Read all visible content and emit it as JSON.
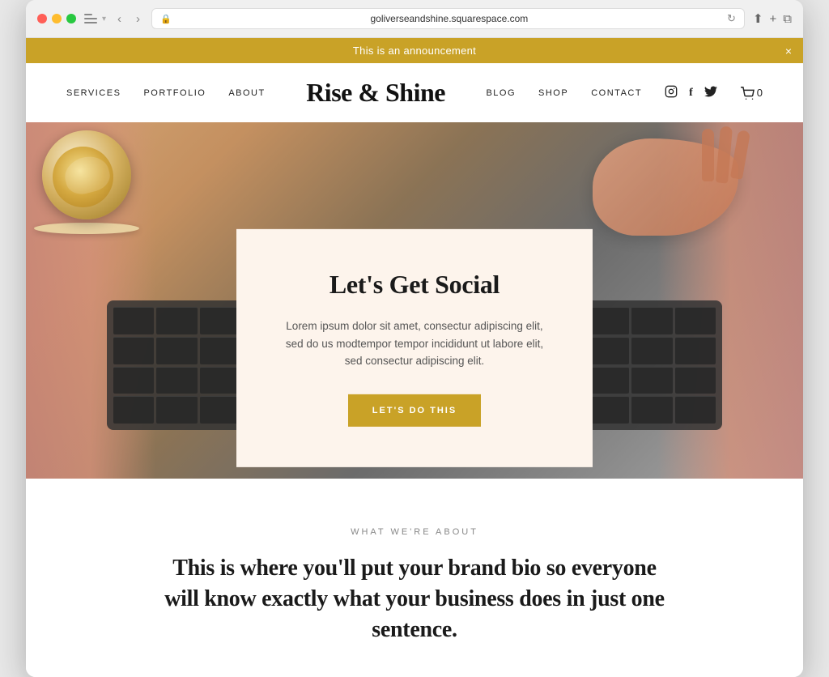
{
  "browser": {
    "url": "goliverseandshine.squarespace.com",
    "back_label": "‹",
    "forward_label": "›"
  },
  "announcement": {
    "text": "This is an announcement",
    "close_label": "×"
  },
  "navbar": {
    "logo": "Rise & Shine",
    "left_links": [
      {
        "label": "SERVICES",
        "key": "services"
      },
      {
        "label": "PORTFOLIO",
        "key": "portfolio"
      },
      {
        "label": "ABOUT",
        "key": "about"
      }
    ],
    "right_links": [
      {
        "label": "BLOG",
        "key": "blog"
      },
      {
        "label": "SHOP",
        "key": "shop"
      },
      {
        "label": "CONTACT",
        "key": "contact"
      }
    ],
    "cart_count": "0",
    "social": {
      "instagram": "⬤",
      "facebook": "f",
      "twitter": "🐦"
    }
  },
  "hero_card": {
    "title": "Let's Get Social",
    "body": "Lorem ipsum dolor sit amet, consectur adipiscing elit, sed do us modtempor tempor incididunt ut labore elit, sed consectur adipiscing elit.",
    "cta_label": "LET'S DO THIS"
  },
  "about": {
    "subtitle": "WHAT WE'RE ABOUT",
    "title": "This is where you'll put your brand bio so everyone will know exactly what your business does in just one sentence."
  }
}
